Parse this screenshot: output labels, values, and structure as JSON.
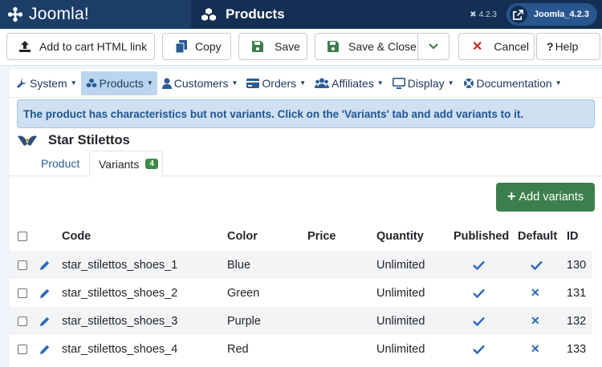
{
  "header": {
    "brand": "Joomla!",
    "page_title": "Products",
    "version": "4.2.3",
    "user_label": "Joomla_4.2.3"
  },
  "toolbar": {
    "add_to_cart": "Add to cart HTML link",
    "copy": "Copy",
    "save": "Save",
    "save_close": "Save & Close",
    "cancel": "Cancel",
    "help": "Help"
  },
  "nav": {
    "items": [
      {
        "label": "System",
        "icon": "wrench-icon"
      },
      {
        "label": "Products",
        "icon": "cubes-icon",
        "active": true
      },
      {
        "label": "Customers",
        "icon": "user-icon"
      },
      {
        "label": "Orders",
        "icon": "credit-card-icon"
      },
      {
        "label": "Affiliates",
        "icon": "users-icon"
      },
      {
        "label": "Display",
        "icon": "monitor-icon"
      },
      {
        "label": "Documentation",
        "icon": "lifebuoy-icon"
      }
    ]
  },
  "alert": {
    "message": "The product has characteristics but not variants. Click on the 'Variants' tab and add variants to it."
  },
  "product": {
    "name": "Star Stilettos"
  },
  "tabs": {
    "product": "Product",
    "variants": "Variants",
    "variants_count": "4"
  },
  "add_variants_label": "Add variants",
  "table": {
    "columns": {
      "code": "Code",
      "color": "Color",
      "price": "Price",
      "quantity": "Quantity",
      "published": "Published",
      "default": "Default",
      "id": "ID"
    },
    "rows": [
      {
        "code": "star_stilettos_shoes_1",
        "color": "Blue",
        "price": "",
        "quantity": "Unlimited",
        "published": true,
        "default": true,
        "id": "130"
      },
      {
        "code": "star_stilettos_shoes_2",
        "color": "Green",
        "price": "",
        "quantity": "Unlimited",
        "published": true,
        "default": false,
        "id": "131"
      },
      {
        "code": "star_stilettos_shoes_3",
        "color": "Purple",
        "price": "",
        "quantity": "Unlimited",
        "published": true,
        "default": false,
        "id": "132"
      },
      {
        "code": "star_stilettos_shoes_4",
        "color": "Red",
        "price": "",
        "quantity": "Unlimited",
        "published": true,
        "default": false,
        "id": "133"
      }
    ]
  },
  "colors": {
    "header_bg": "#132f53",
    "brand_bg": "#1c3d68",
    "add_button": "#3c7f4c",
    "alert_bg": "#cfe0f1",
    "accent": "#2a69b8"
  }
}
